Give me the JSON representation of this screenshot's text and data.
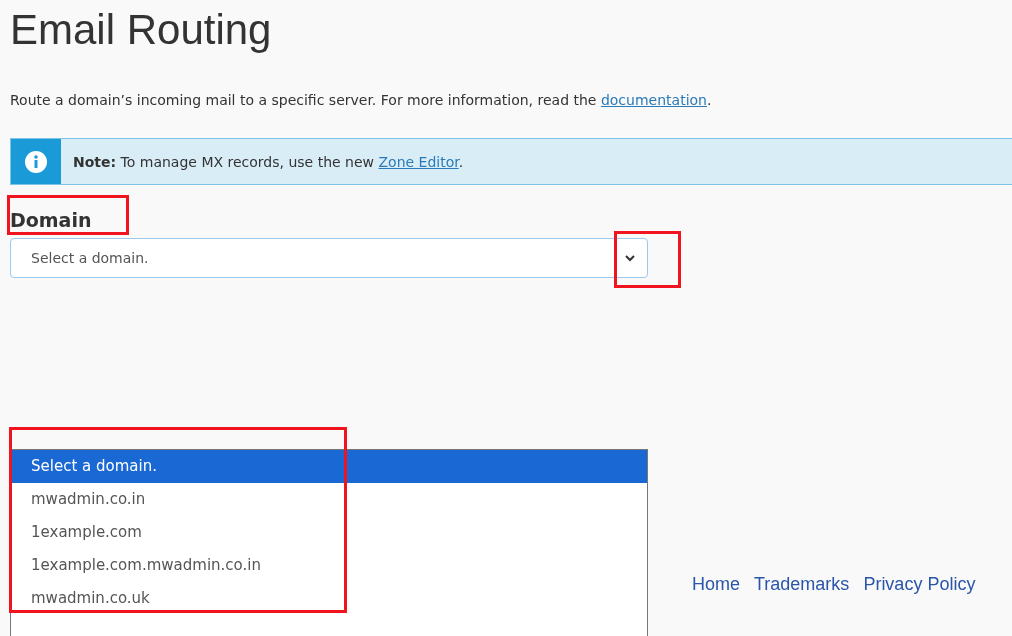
{
  "page": {
    "title": "Email Routing",
    "intro": "Route a domain’s incoming mail to a specific server. For more information, read the ",
    "intro_link": "documentation",
    "intro_end": "."
  },
  "note": {
    "label": "Note:",
    "text": " To manage MX records, use the new ",
    "link": "Zone Editor",
    "end": "."
  },
  "domain": {
    "label": "Domain",
    "label_highlighted": true,
    "value": "Select a domain.",
    "caret_highlighted": true,
    "list_highlighted": true,
    "options": [
      {
        "label": "Select a domain.",
        "selected": true
      },
      {
        "label": "mwadmin.co.in",
        "selected": false
      },
      {
        "label": "1example.com",
        "selected": false
      },
      {
        "label": "1example.com.mwadmin.co.in",
        "selected": false
      },
      {
        "label": "mwadmin.co.uk",
        "selected": false
      }
    ]
  },
  "footer": {
    "links": [
      "Home",
      "Trademarks",
      "Privacy Policy"
    ]
  }
}
